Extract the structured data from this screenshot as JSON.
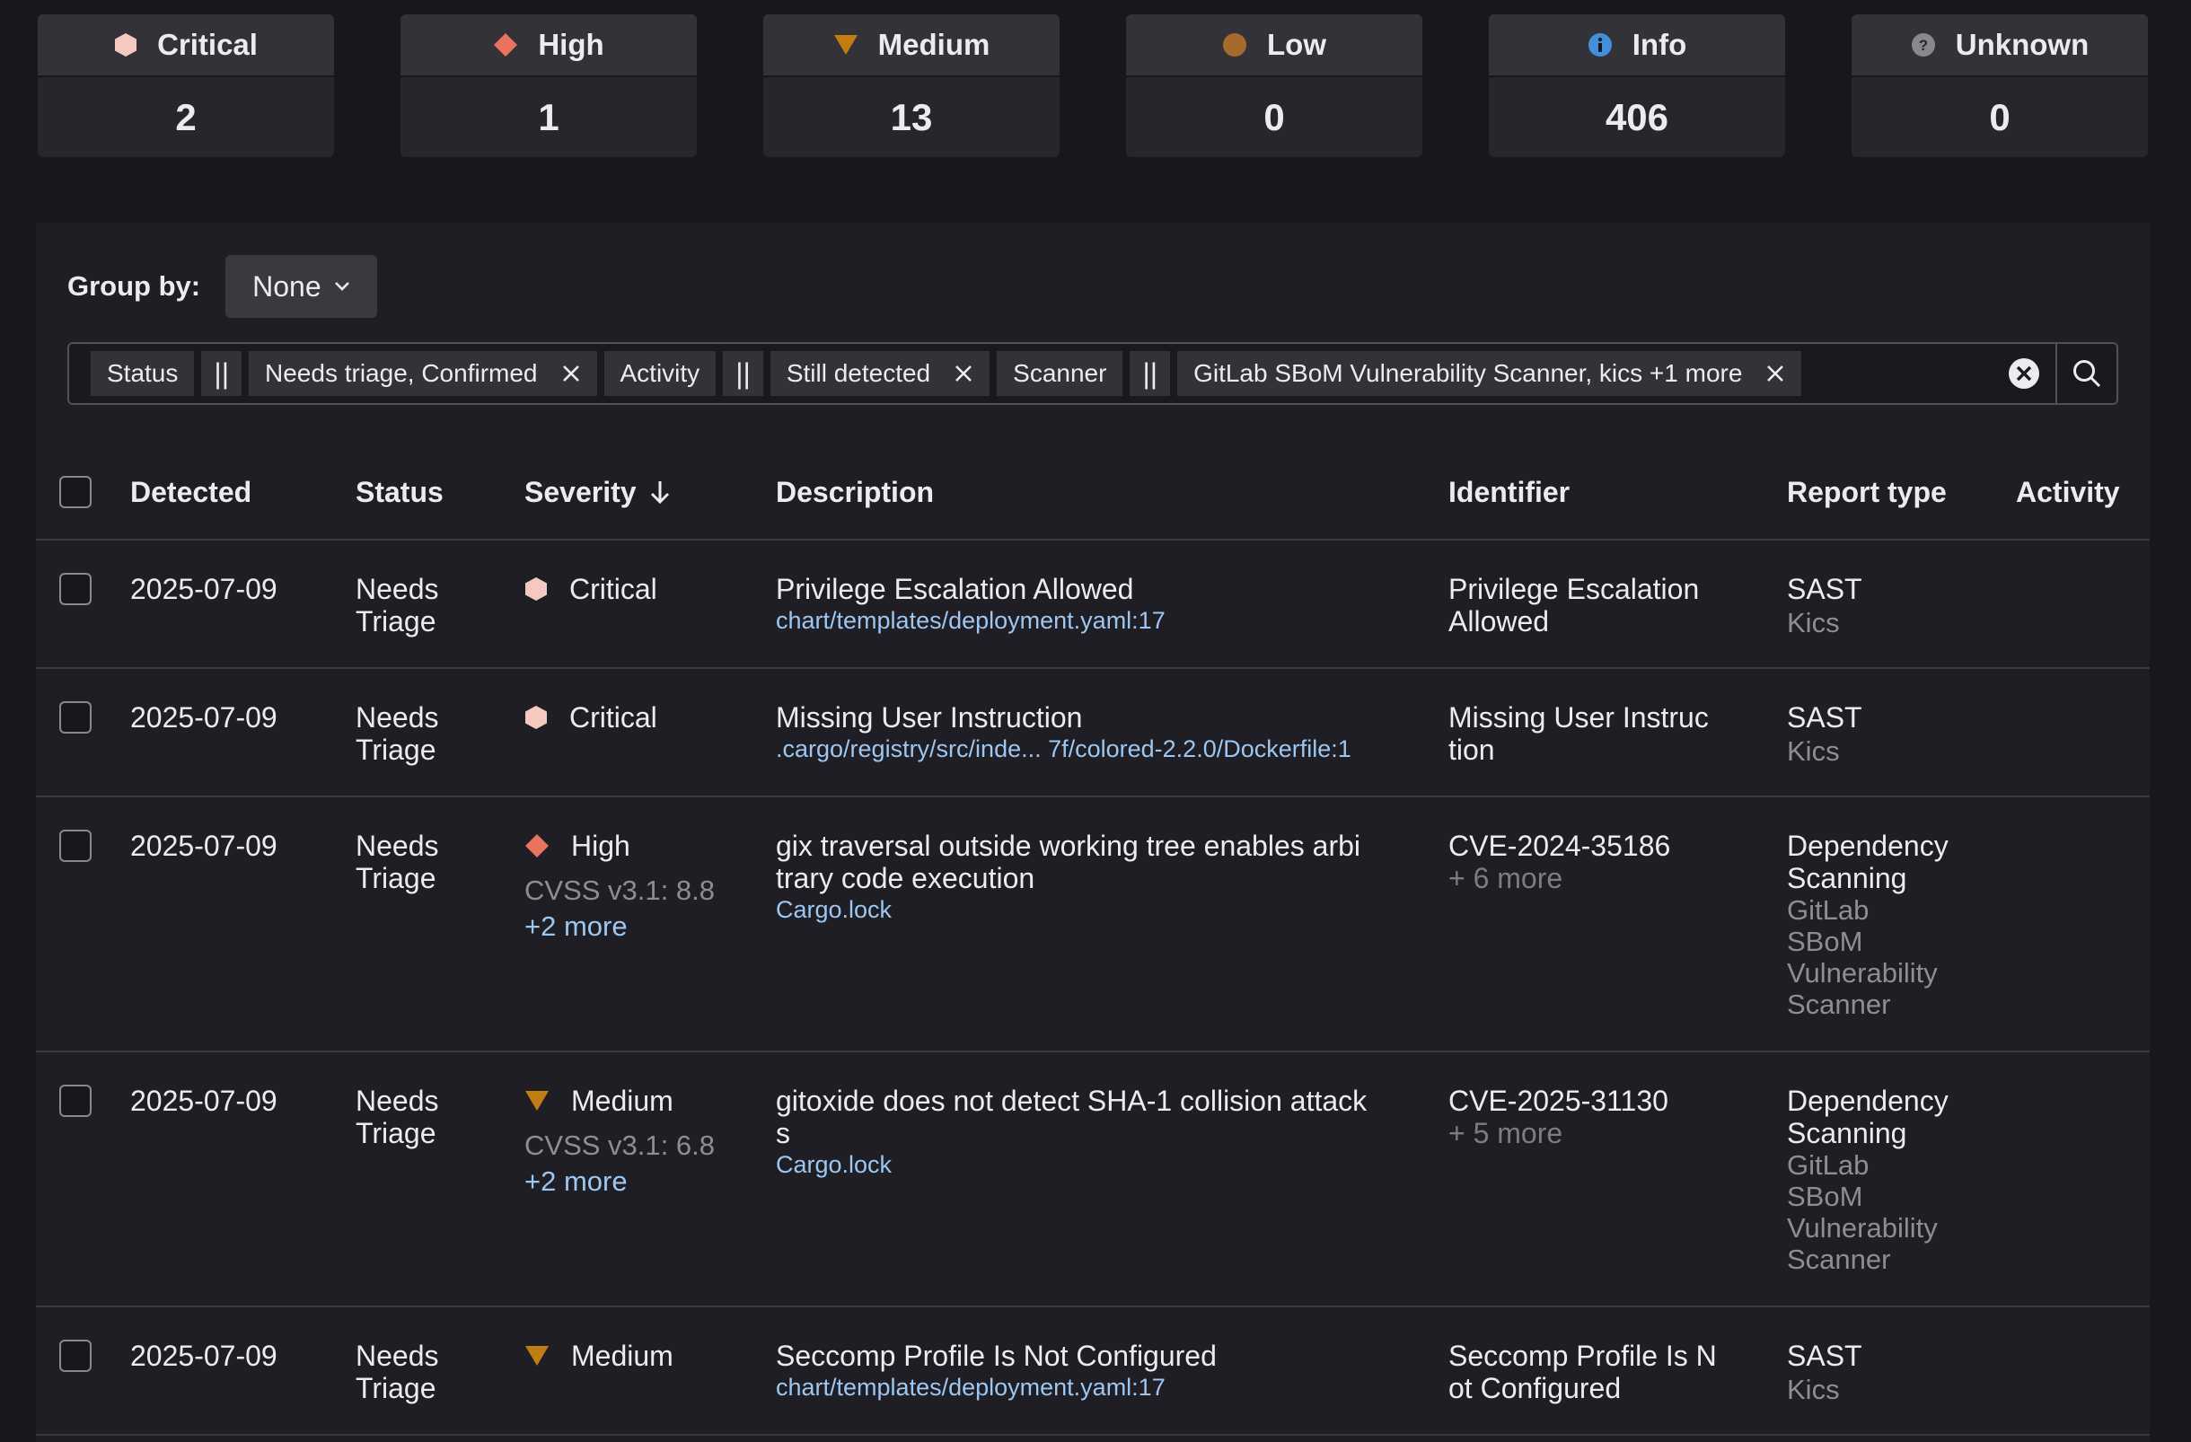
{
  "summary": [
    {
      "label": "Critical",
      "count": "2",
      "icon": "critical-hexagon-icon",
      "color": "#f5c9c0"
    },
    {
      "label": "High",
      "count": "1",
      "icon": "high-diamond-icon",
      "color": "#e9735e"
    },
    {
      "label": "Medium",
      "count": "13",
      "icon": "medium-triangle-icon",
      "color": "#c17d10"
    },
    {
      "label": "Low",
      "count": "0",
      "icon": "low-circle-icon",
      "color": "#a86a2c"
    },
    {
      "label": "Info",
      "count": "406",
      "icon": "info-icon",
      "color": "#428fdc"
    },
    {
      "label": "Unknown",
      "count": "0",
      "icon": "unknown-question-icon",
      "color": "#89888d"
    }
  ],
  "groupby": {
    "label": "Group by:",
    "value": "None"
  },
  "filters": [
    {
      "key": "Status",
      "op": "||",
      "value": "Needs triage, Confirmed"
    },
    {
      "key": "Activity",
      "op": "||",
      "value": "Still detected"
    },
    {
      "key": "Scanner",
      "op": "||",
      "value": "GitLab SBoM Vulnerability Scanner, kics +1 more"
    }
  ],
  "table": {
    "headers": {
      "detected": "Detected",
      "status": "Status",
      "severity": "Severity",
      "description": "Description",
      "identifier": "Identifier",
      "report_type": "Report type",
      "activity": "Activity"
    },
    "rows": [
      {
        "detected": "2025-07-09",
        "status": [
          "Needs",
          "Triage"
        ],
        "severity": "Critical",
        "sev_icon": "critical-hexagon-icon",
        "cvss": "",
        "more": "",
        "desc": [
          "Privilege Escalation Allowed"
        ],
        "location": "chart/templates/deployment.yaml:17",
        "identifier": [
          "Privilege Escalation",
          "Allowed"
        ],
        "id_more": "",
        "report": [
          "SAST"
        ],
        "scanner": [
          "Kics"
        ]
      },
      {
        "detected": "2025-07-09",
        "status": [
          "Needs",
          "Triage"
        ],
        "severity": "Critical",
        "sev_icon": "critical-hexagon-icon",
        "cvss": "",
        "more": "",
        "desc": [
          "Missing User Instruction"
        ],
        "location": ".cargo/registry/src/inde... 7f/colored-2.2.0/Dockerfile:1",
        "identifier": [
          "Missing User Instruc",
          "tion"
        ],
        "id_more": "",
        "report": [
          "SAST"
        ],
        "scanner": [
          "Kics"
        ]
      },
      {
        "detected": "2025-07-09",
        "status": [
          "Needs",
          "Triage"
        ],
        "severity": "High",
        "sev_icon": "high-diamond-icon",
        "cvss": "CVSS v3.1: 8.8",
        "more": "+2 more",
        "desc": [
          "gix traversal outside working tree enables arbi",
          "trary code execution"
        ],
        "location": "Cargo.lock",
        "identifier": [
          "CVE-2024-35186"
        ],
        "id_more": "+ 6 more",
        "report": [
          "Dependency",
          "Scanning"
        ],
        "scanner": [
          "GitLab",
          "SBoM",
          "Vulnerability",
          "Scanner"
        ]
      },
      {
        "detected": "2025-07-09",
        "status": [
          "Needs",
          "Triage"
        ],
        "severity": "Medium",
        "sev_icon": "medium-triangle-icon",
        "cvss": "CVSS v3.1: 6.8",
        "more": "+2 more",
        "desc": [
          "gitoxide does not detect SHA-1 collision attack",
          "s"
        ],
        "location": "Cargo.lock",
        "identifier": [
          "CVE-2025-31130"
        ],
        "id_more": "+ 5 more",
        "report": [
          "Dependency",
          "Scanning"
        ],
        "scanner": [
          "GitLab",
          "SBoM",
          "Vulnerability",
          "Scanner"
        ]
      },
      {
        "detected": "2025-07-09",
        "status": [
          "Needs",
          "Triage"
        ],
        "severity": "Medium",
        "sev_icon": "medium-triangle-icon",
        "cvss": "",
        "more": "",
        "desc": [
          "Seccomp Profile Is Not Configured"
        ],
        "location": "chart/templates/deployment.yaml:17",
        "identifier": [
          "Seccomp Profile Is N",
          "ot Configured"
        ],
        "id_more": "",
        "report": [
          "SAST"
        ],
        "scanner": [
          "Kics"
        ]
      }
    ]
  }
}
